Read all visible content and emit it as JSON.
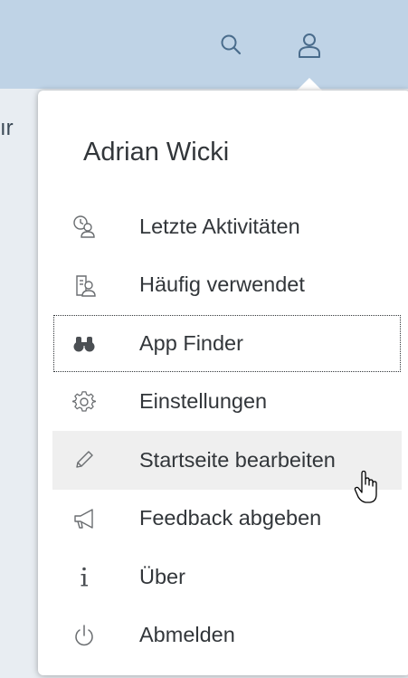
{
  "shell": {
    "background_fragment": "ır",
    "buttons": [
      {
        "icon": "search-icon"
      },
      {
        "icon": "user-icon"
      }
    ]
  },
  "user_menu": {
    "name": "Adrian Wicki",
    "items": [
      {
        "label": "Letzte Aktivitäten",
        "icon": "recent-activities-icon",
        "state": ""
      },
      {
        "label": "Häufig verwendet",
        "icon": "frequently-used-icon",
        "state": ""
      },
      {
        "label": "App Finder",
        "icon": "binoculars-icon",
        "state": "focused"
      },
      {
        "label": "Einstellungen",
        "icon": "gear-icon",
        "state": ""
      },
      {
        "label": "Startseite bearbeiten",
        "icon": "pencil-icon",
        "state": "hover"
      },
      {
        "label": "Feedback abgeben",
        "icon": "megaphone-icon",
        "state": ""
      },
      {
        "label": "Über",
        "icon": "info-icon",
        "state": ""
      },
      {
        "label": "Abmelden",
        "icon": "power-icon",
        "state": ""
      }
    ]
  },
  "colors": {
    "shellbar": "#bfd3e6",
    "text": "#32363a",
    "icon": "#6a6d70",
    "hover": "#efefef"
  }
}
